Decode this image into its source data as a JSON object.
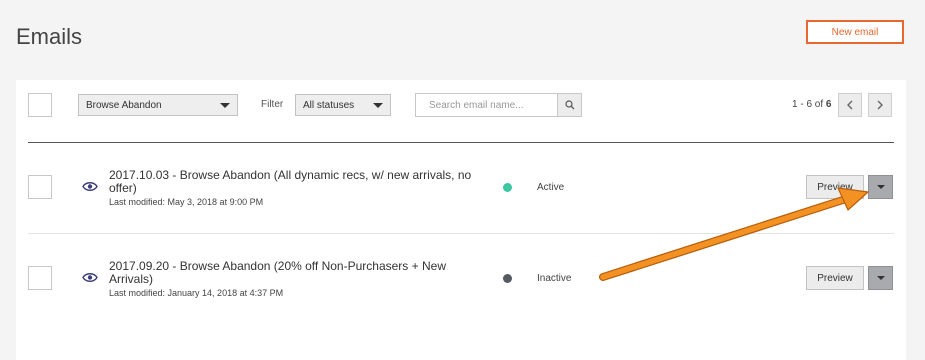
{
  "header": {
    "title": "Emails",
    "new_email_label": "New email"
  },
  "toolbar": {
    "campaign_select": "Browse Abandon",
    "filter_label": "Filter",
    "status_select": "All statuses",
    "search_placeholder": "Search email name...",
    "pager_range": "1 - 6 of ",
    "pager_total": "6"
  },
  "emails": [
    {
      "title": "2017.10.03 - Browse Abandon (All dynamic recs, w/ new arrivals, no offer)",
      "modified": "Last modified: May 3, 2018 at 9:00 PM",
      "status": "Active",
      "status_color": "#3cc6a4",
      "preview_label": "Preview"
    },
    {
      "title": "2017.09.20 - Browse Abandon (20% off Non-Purchasers + New Arrivals)",
      "modified": "Last modified: January 14, 2018 at 4:37 PM",
      "status": "Inactive",
      "status_color": "#555a63",
      "preview_label": "Preview"
    }
  ],
  "colors": {
    "accent": "#e8682f",
    "annotation_arrow": "#f08a1c"
  }
}
